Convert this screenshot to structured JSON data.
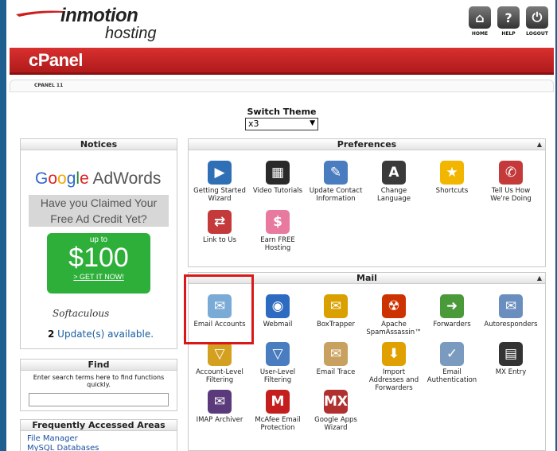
{
  "brand": {
    "name": "inmotion",
    "sub": "hosting"
  },
  "topnav": [
    {
      "label": "HOME",
      "icon": "home-icon",
      "glyph": "⌂"
    },
    {
      "label": "HELP",
      "icon": "help-icon",
      "glyph": "?"
    },
    {
      "label": "LOGOUT",
      "icon": "logout-icon",
      "glyph": "⏻"
    }
  ],
  "app_title": "cPanel",
  "breadcrumb": "CPANEL 11",
  "switch_theme": {
    "label": "Switch Theme",
    "value": "x3"
  },
  "notices": {
    "title": "Notices",
    "ad": {
      "brand_parts": [
        "G",
        "o",
        "o",
        "g",
        "l",
        "e"
      ],
      "product": "AdWords",
      "claim_line1": "Have you Claimed Your",
      "claim_line2": "Free Ad Credit Yet?",
      "up_to": "up to",
      "amount": "$100",
      "cta": "> GET IT NOW!"
    },
    "softaculous": "Softaculous",
    "update_count": "2",
    "update_text": " Update(s) available."
  },
  "find": {
    "title": "Find",
    "description": "Enter search terms here to find functions quickly."
  },
  "frequent": {
    "title": "Frequently Accessed Areas",
    "links": [
      "File Manager",
      "MySQL Databases"
    ]
  },
  "preferences": {
    "title": "Preferences",
    "items": [
      {
        "label": "Getting Started Wizard",
        "icon": "wizard-icon",
        "color": "#2f6fb5",
        "glyph": "▶"
      },
      {
        "label": "Video Tutorials",
        "icon": "clapperboard-icon",
        "color": "#2a2a2a",
        "glyph": "▦"
      },
      {
        "label": "Update Contact Information",
        "icon": "contact-icon",
        "color": "#4a7cc0",
        "glyph": "✎"
      },
      {
        "label": "Change Language",
        "icon": "language-icon",
        "color": "#3a3a3a",
        "glyph": "A"
      },
      {
        "label": "Shortcuts",
        "icon": "star-icon",
        "color": "#f2b600",
        "glyph": "★"
      },
      {
        "label": "Tell Us How We're Doing",
        "icon": "megaphone-icon",
        "color": "#c43a3a",
        "glyph": "✆"
      },
      {
        "label": "Link to Us",
        "icon": "link-icon",
        "color": "#c43a3a",
        "glyph": "⇄"
      },
      {
        "label": "Earn FREE Hosting",
        "icon": "piggy-bank-icon",
        "color": "#e87aa0",
        "glyph": "$"
      }
    ]
  },
  "mail": {
    "title": "Mail",
    "items": [
      {
        "label": "Email Accounts",
        "icon": "envelope-icon",
        "color": "#7aaad6",
        "glyph": "✉"
      },
      {
        "label": "Webmail",
        "icon": "globe-icon",
        "color": "#2d6bc0",
        "glyph": "◉"
      },
      {
        "label": "BoxTrapper",
        "icon": "trap-icon",
        "color": "#d9a000",
        "glyph": "✉"
      },
      {
        "label": "Apache SpamAssassin™",
        "icon": "spamassassin-icon",
        "color": "#cc3300",
        "glyph": "☢"
      },
      {
        "label": "Forwarders",
        "icon": "forward-icon",
        "color": "#4a9a3a",
        "glyph": "➜"
      },
      {
        "label": "Autoresponders",
        "icon": "autoresponder-icon",
        "color": "#6a8fbf",
        "glyph": "✉"
      },
      {
        "label": "Account-Level Filtering",
        "icon": "filter-icon",
        "color": "#d4a020",
        "glyph": "▽"
      },
      {
        "label": "User-Level Filtering",
        "icon": "user-filter-icon",
        "color": "#4a7cc0",
        "glyph": "▽"
      },
      {
        "label": "Email Trace",
        "icon": "trace-icon",
        "color": "#c8a060",
        "glyph": "✉"
      },
      {
        "label": "Import Addresses and Forwarders",
        "icon": "import-icon",
        "color": "#e0a000",
        "glyph": "⬇"
      },
      {
        "label": "Email Authentication",
        "icon": "authentication-icon",
        "color": "#7a9ac0",
        "glyph": "✓"
      },
      {
        "label": "MX Entry",
        "icon": "server-icon",
        "color": "#333333",
        "glyph": "▤"
      },
      {
        "label": "IMAP Archiver",
        "icon": "imap-icon",
        "color": "#5a3a7a",
        "glyph": "✉"
      },
      {
        "label": "McAfee Email Protection",
        "icon": "mcafee-icon",
        "color": "#c41e1e",
        "glyph": "M"
      },
      {
        "label": "Google Apps Wizard",
        "icon": "google-apps-icon",
        "color": "#b03030",
        "glyph": "MX"
      }
    ]
  }
}
